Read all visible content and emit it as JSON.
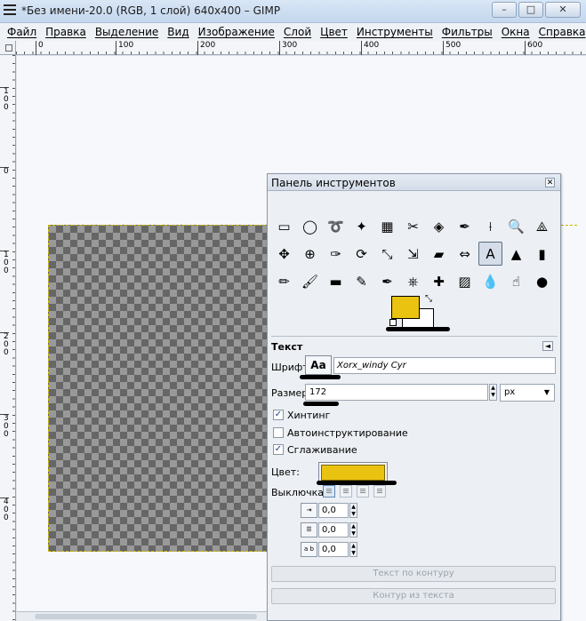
{
  "window": {
    "title": "*Без имени-20.0 (RGB, 1 слой) 640x400 – GIMP",
    "minimize": "–",
    "maximize": "□",
    "close": "✕"
  },
  "menu": [
    "Файл",
    "Правка",
    "Выделение",
    "Вид",
    "Изображение",
    "Слой",
    "Цвет",
    "Инструменты",
    "Фильтры",
    "Окна",
    "Справка"
  ],
  "ruler": {
    "h_ticks": [
      "0",
      "100",
      "200",
      "300",
      "400",
      "500",
      "600"
    ],
    "v_ticks": [
      "100",
      "0",
      "100",
      "200",
      "300",
      "400"
    ]
  },
  "toolbox": {
    "title": "Панель инструментов",
    "close": "✕",
    "tools": [
      "rect-select-icon",
      "ellipse-select-icon",
      "free-select-icon",
      "fuzzy-select-icon",
      "select-by-color-icon",
      "scissors-icon",
      "foreground-select-icon",
      "paths-icon",
      "color-picker-icon",
      "zoom-icon",
      "measure-icon",
      "move-icon",
      "align-icon",
      "crop-icon",
      "rotate-icon",
      "scale-icon",
      "shear-icon",
      "perspective-icon",
      "flip-icon",
      "text-icon",
      "bucket-fill-icon",
      "blend-icon",
      "pencil-icon",
      "paintbrush-icon",
      "eraser-icon",
      "airbrush-icon",
      "ink-icon",
      "clone-icon",
      "heal-icon",
      "perspective-clone-icon",
      "blur-icon",
      "smudge-icon",
      "dodge-burn-icon"
    ],
    "tool_glyphs": [
      "▭",
      "◯",
      "➰",
      "✦",
      "▦",
      "✂",
      "◈",
      "✒",
      "⟊",
      "🔍",
      "⟁",
      "✥",
      "⊕",
      "✑",
      "⟳",
      "⤡",
      "⇲",
      "▰",
      "⇔",
      "A",
      "▲",
      "▮",
      "✏",
      "🖌",
      "▬",
      "✎",
      "✒",
      "⎈",
      "✚",
      "▨",
      "💧",
      "☝",
      "●"
    ],
    "active_tool_index": 19,
    "fg_color": "#eac311",
    "bg_color": "#ffffff"
  },
  "options": {
    "title": "Текст",
    "font_label": "Шрифт:",
    "font_button": "Aa",
    "font_value": "Xorx_windy Cyr",
    "size_label": "Размер:",
    "size_value": "172",
    "unit": "px",
    "hinting_label": "Хинтинг",
    "hinting_checked": "✓",
    "autohint_label": "Автоинструктирование",
    "antialias_label": "Сглаживание",
    "antialias_checked": "✓",
    "color_label": "Цвет:",
    "text_color": "#eac311",
    "justify_label": "Выключка:",
    "indent_value": "0,0",
    "line_spacing_value": "0,0",
    "letter_spacing_value": "0,0",
    "letter_spacing_icon": "a b",
    "text_along_path": "Текст по контуру",
    "path_from_text": "Контур из текста"
  }
}
